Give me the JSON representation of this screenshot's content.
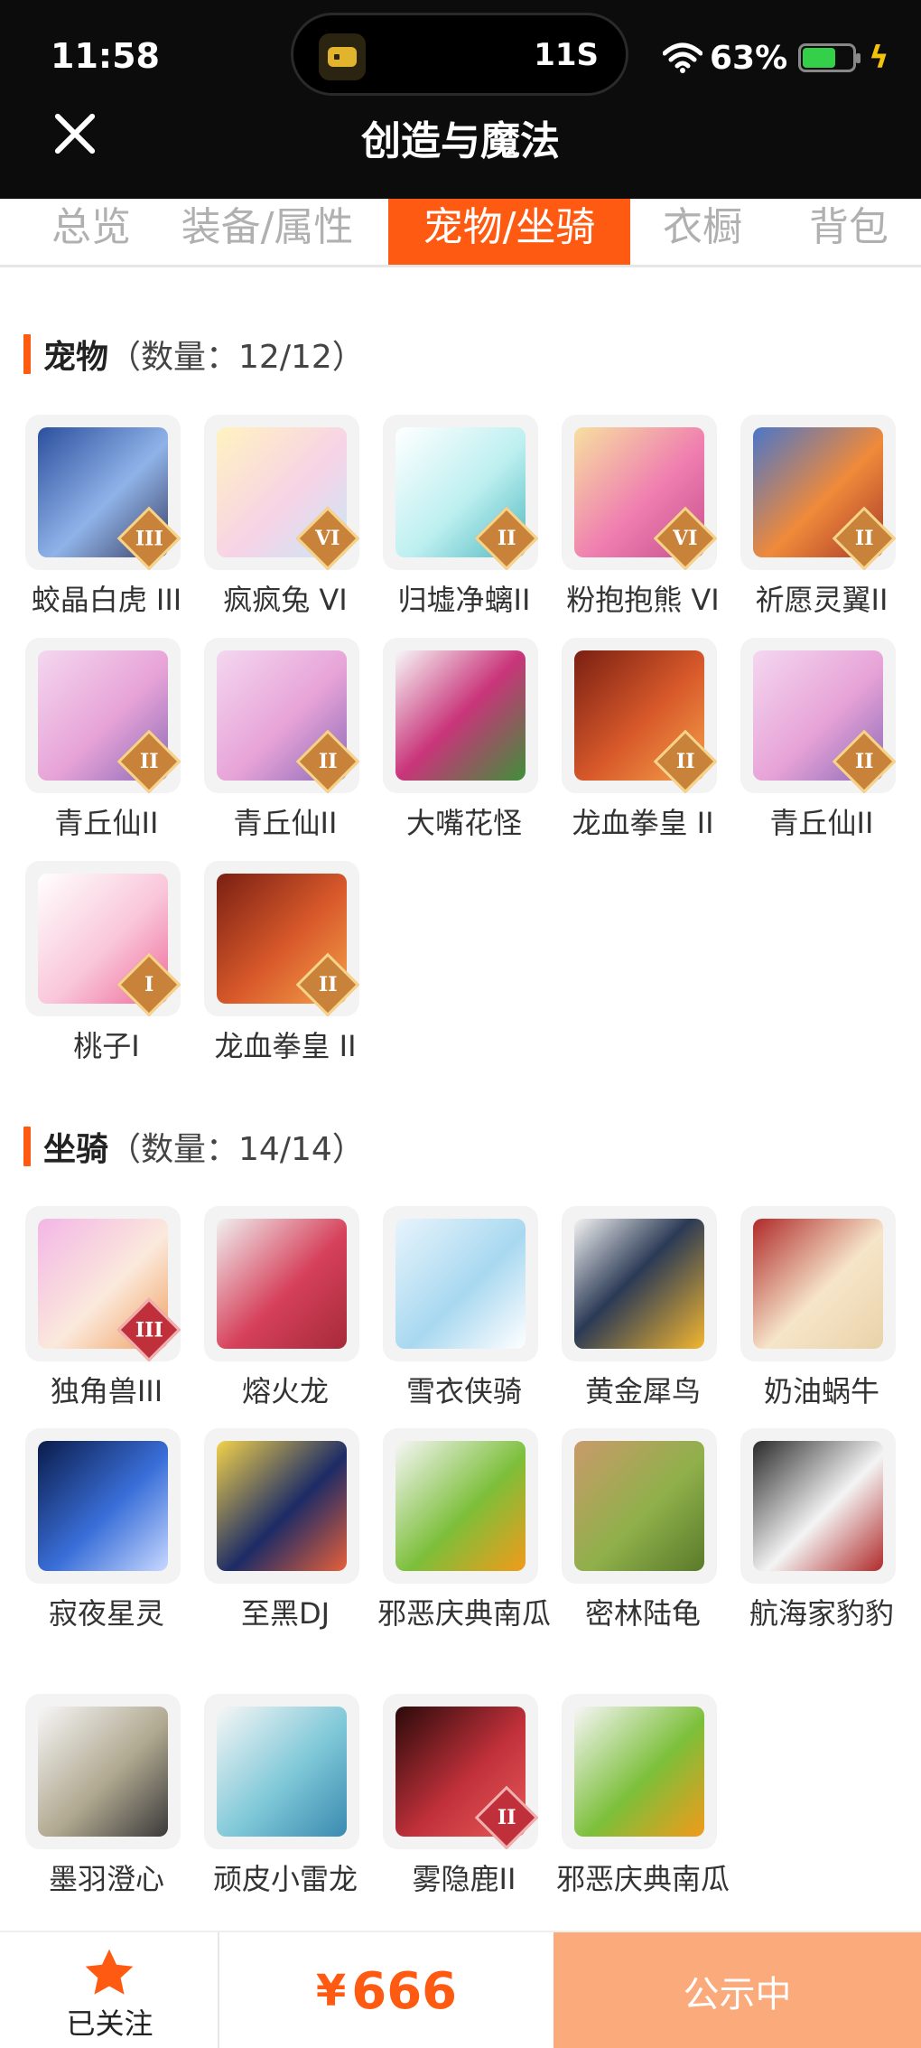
{
  "status_bar": {
    "time": "11:58",
    "island_text": "11S",
    "battery_percent": "63%",
    "battery_level": 0.63,
    "icons": [
      "app-icon",
      "wifi-icon",
      "battery-icon",
      "charging-bolt-icon"
    ]
  },
  "header": {
    "title": "创造与魔法",
    "close_icon": "close-icon"
  },
  "tabs": [
    {
      "label": "总览",
      "active": false
    },
    {
      "label": "装备/属性",
      "active": false
    },
    {
      "label": "宠物/坐骑",
      "active": true
    },
    {
      "label": "衣橱",
      "active": false
    },
    {
      "label": "背包",
      "active": false
    }
  ],
  "pets": {
    "title": "宠物",
    "count": "（数量：12/12）",
    "items": [
      {
        "name": "蛟晶白虎 III",
        "rank": "III"
      },
      {
        "name": "疯疯兔 VI",
        "rank": "VI"
      },
      {
        "name": "归墟净螭II",
        "rank": "II"
      },
      {
        "name": "粉抱抱熊 VI",
        "rank": "VI"
      },
      {
        "name": "祈愿灵翼II",
        "rank": "II"
      },
      {
        "name": "青丘仙II",
        "rank": "II"
      },
      {
        "name": "青丘仙II",
        "rank": "II"
      },
      {
        "name": "大嘴花怪",
        "rank": ""
      },
      {
        "name": "龙血拳皇 II",
        "rank": "II"
      },
      {
        "name": "青丘仙II",
        "rank": "II"
      },
      {
        "name": "桃子I",
        "rank": "I"
      },
      {
        "name": "龙血拳皇 II",
        "rank": "II"
      }
    ]
  },
  "mounts": {
    "title": "坐骑",
    "count": "（数量：14/14）",
    "items": [
      {
        "name": "独角兽III",
        "rank": "III"
      },
      {
        "name": "熔火龙",
        "rank": ""
      },
      {
        "name": "雪衣侠骑",
        "rank": ""
      },
      {
        "name": "黄金犀鸟",
        "rank": ""
      },
      {
        "name": "奶油蜗牛",
        "rank": ""
      },
      {
        "name": "寂夜星灵",
        "rank": ""
      },
      {
        "name": "至黑DJ",
        "rank": ""
      },
      {
        "name": "邪恶庆典南瓜",
        "rank": ""
      },
      {
        "name": "密林陆龟",
        "rank": ""
      },
      {
        "name": "航海家豹豹",
        "rank": ""
      },
      {
        "name": "墨羽澄心",
        "rank": ""
      },
      {
        "name": "顽皮小雷龙",
        "rank": ""
      },
      {
        "name": "雾隐鹿II",
        "rank": "II"
      },
      {
        "name": "邪恶庆典南瓜",
        "rank": ""
      }
    ]
  },
  "bottom_bar": {
    "follow_label": "已关注",
    "currency": "¥",
    "price": "666",
    "status_button": "公示中"
  },
  "colors": {
    "accent": "#ff5a12",
    "status_button_bg": "#fbaa7c",
    "header_bg": "#0c0c0c"
  }
}
